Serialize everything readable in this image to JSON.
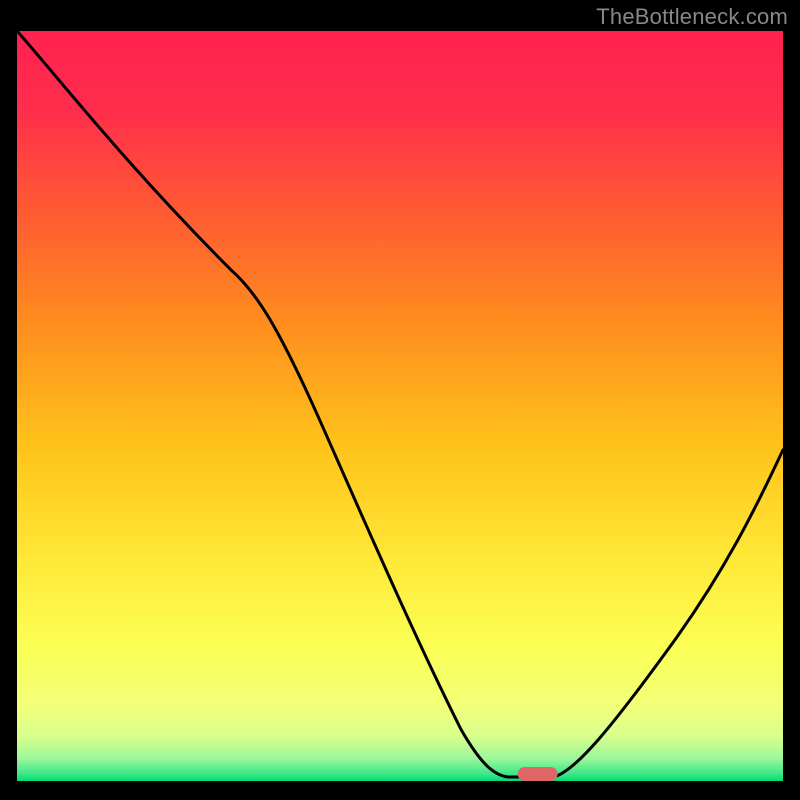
{
  "watermark": "TheBottleneck.com",
  "chart_data": {
    "type": "line",
    "title": "",
    "xlabel": "",
    "ylabel": "",
    "xlim": [
      0,
      100
    ],
    "ylim": [
      0,
      100
    ],
    "background_gradient": {
      "top": "#ff2a55",
      "upper_mid": "#ff6a2a",
      "mid": "#ffd400",
      "lower_mid": "#f7ff60",
      "near_bottom": "#d4ff80",
      "bottom": "#00e676"
    },
    "series": [
      {
        "name": "curve",
        "x": [
          0,
          10,
          20,
          28,
          40,
          52,
          60,
          64,
          70,
          78,
          86,
          94,
          100
        ],
        "y": [
          100,
          90,
          77,
          68,
          47,
          25,
          6,
          1,
          0,
          3,
          16,
          33,
          44
        ]
      }
    ],
    "marker": {
      "name": "optimal-point",
      "x": 68,
      "y": 0.8,
      "color": "#e06666",
      "shape": "rounded-rect"
    },
    "grid": false,
    "legend": false
  }
}
